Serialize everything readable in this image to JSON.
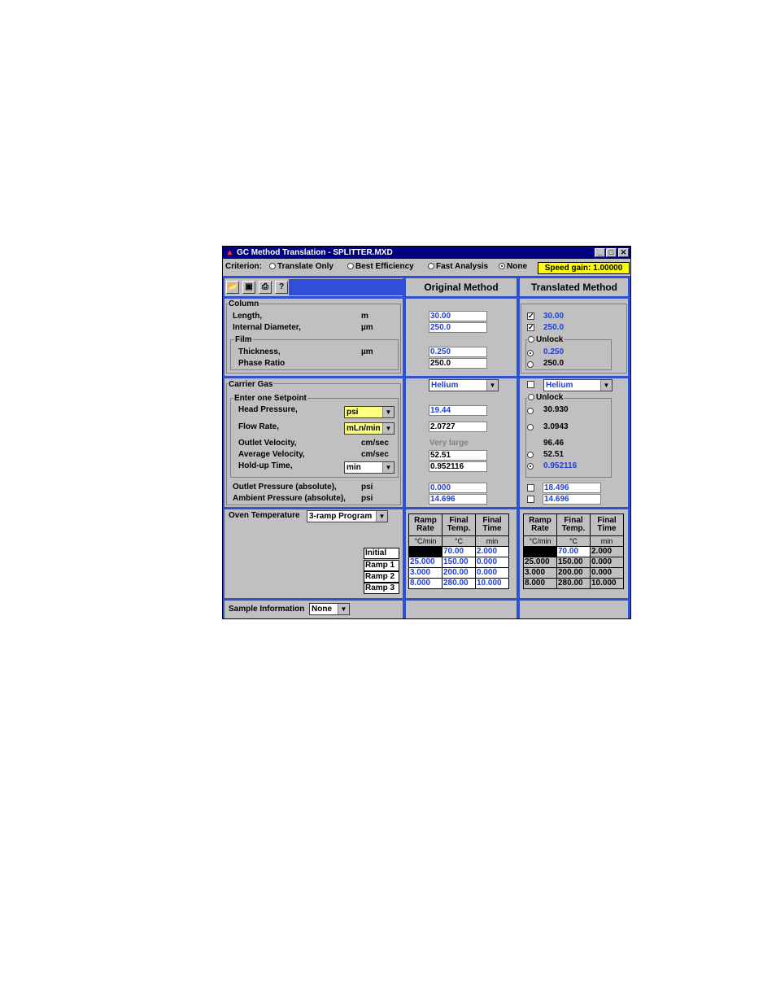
{
  "window": {
    "title": "GC Method Translation - SPLITTER.MXD",
    "controls": {
      "minimize": "_",
      "maximize": "□",
      "close": "✕"
    }
  },
  "criterion": {
    "label": "Criterion:",
    "options": [
      "Translate Only",
      "Best Efficiency",
      "Fast Analysis",
      "None"
    ],
    "selected": "None",
    "speed_gain": "Speed gain: 1.00000"
  },
  "toolbar": {
    "icons": [
      "open-icon",
      "save-icon",
      "print-icon",
      "help-icon"
    ]
  },
  "headers": {
    "original": "Original Method",
    "translated": "Translated Method"
  },
  "column": {
    "title": "Column",
    "length_label": "Length,",
    "length_unit": "m",
    "id_label": "Internal Diameter,",
    "id_unit": "µm",
    "film_title": "Film",
    "thickness_label": "Thickness,",
    "thickness_unit": "µm",
    "phase_label": "Phase Ratio",
    "original": {
      "length": "30.00",
      "id": "250.0",
      "thickness": "0.250",
      "phase": "250.0"
    },
    "translated": {
      "length": "30.00",
      "id": "250.0",
      "unlock": "Unlock",
      "thickness": "0.250",
      "phase": "250.0"
    }
  },
  "carrier": {
    "title": "Carrier Gas",
    "setpoint_title": "Enter one Setpoint",
    "head_label": "Head Pressure,",
    "head_unit": "psi",
    "flow_label": "Flow Rate,",
    "flow_unit": "mLn/min",
    "outlet_vel_label": "Outlet Velocity,",
    "outlet_vel_unit": "cm/sec",
    "avg_vel_label": "Average Velocity,",
    "avg_vel_unit": "cm/sec",
    "holdup_label": "Hold-up Time,",
    "holdup_unit": "min",
    "outlet_p_label": "Outlet Pressure (absolute),",
    "outlet_p_unit": "psi",
    "ambient_p_label": "Ambient Pressure (absolute),",
    "ambient_p_unit": "psi",
    "original": {
      "gas": "Helium",
      "head": "19.44",
      "flow": "2.0727",
      "outlet_vel": "Very large",
      "avg_vel": "52.51",
      "holdup": "0.952116",
      "outlet_p": "0.000",
      "ambient_p": "14.696"
    },
    "translated": {
      "gas": "Helium",
      "unlock": "Unlock",
      "head": "30.930",
      "flow": "3.0943",
      "outlet_vel": "96.46",
      "avg_vel": "52.51",
      "holdup": "0.952116",
      "outlet_p": "18.496",
      "ambient_p": "14.696"
    }
  },
  "oven": {
    "title": "Oven Temperature",
    "program": "3-ramp Program",
    "row_labels": [
      "Initial",
      "Ramp 1",
      "Ramp 2",
      "Ramp 3"
    ],
    "col_headers": [
      [
        "Ramp",
        "Rate"
      ],
      [
        "Final",
        "Temp."
      ],
      [
        "Final",
        "Time"
      ]
    ],
    "units": [
      "°C/min",
      "°C",
      "min"
    ],
    "original": [
      [
        "",
        "70.00",
        "2.000"
      ],
      [
        "25.000",
        "150.00",
        "0.000"
      ],
      [
        "3.000",
        "200.00",
        "0.000"
      ],
      [
        "8.000",
        "280.00",
        "10.000"
      ]
    ],
    "translated": [
      [
        "",
        "70.00",
        "2.000"
      ],
      [
        "25.000",
        "150.00",
        "0.000"
      ],
      [
        "3.000",
        "200.00",
        "0.000"
      ],
      [
        "8.000",
        "280.00",
        "10.000"
      ]
    ]
  },
  "sample": {
    "label": "Sample Information",
    "value": "None"
  }
}
